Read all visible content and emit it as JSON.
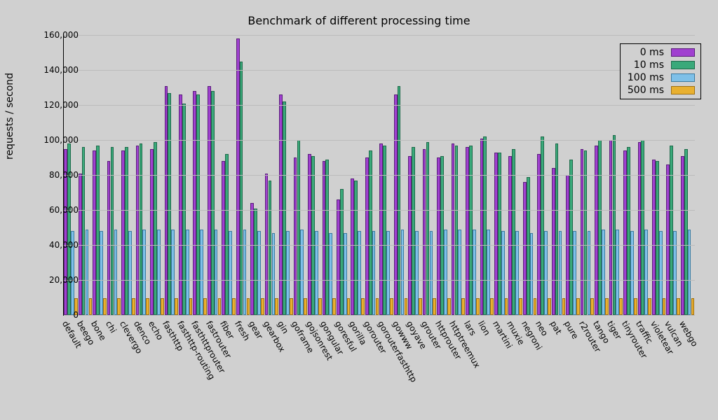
{
  "chart_data": {
    "type": "bar",
    "title": "Benchmark of different processing time",
    "ylabel": "requests / second",
    "ylim": [
      0,
      160000
    ],
    "yticks": [
      0,
      20000,
      40000,
      60000,
      80000,
      100000,
      120000,
      140000,
      160000
    ],
    "legend_position": "upper right",
    "categories": [
      "default",
      "beego",
      "bone",
      "chi",
      "clevergo",
      "denco",
      "echo",
      "fasthttp",
      "fasthttp-routing",
      "fasthttprouter",
      "fastrouter",
      "fiber",
      "fresh",
      "gear",
      "gearbox",
      "gin",
      "goframe",
      "gojsonrest",
      "gongular",
      "goresful",
      "gorilla",
      "gorouter",
      "gorouterfasthttp",
      "gowww",
      "goyave",
      "grouter",
      "httprouter",
      "httptreemux",
      "lars",
      "lion",
      "martini",
      "muxie",
      "negroni",
      "neo",
      "pat",
      "pure",
      "r2router",
      "tango",
      "tiger",
      "tinyrouter",
      "traffic",
      "violetear",
      "vulcan",
      "webgo"
    ],
    "series": [
      {
        "name": "0 ms",
        "color": "#a040d0",
        "values": [
          95000,
          81000,
          94000,
          88000,
          94000,
          97000,
          95000,
          131000,
          126000,
          128000,
          131000,
          88000,
          158000,
          64000,
          81000,
          126000,
          90000,
          92000,
          88000,
          66000,
          78000,
          90000,
          98000,
          126000,
          91000,
          95000,
          90000,
          98000,
          96000,
          101000,
          93000,
          91000,
          76000,
          92000,
          84000,
          80000,
          95000,
          97000,
          100000,
          94000,
          99000,
          89000,
          86000,
          91000
        ]
      },
      {
        "name": "10 ms",
        "color": "#3aa97a",
        "values": [
          98000,
          96000,
          97000,
          96000,
          96000,
          98000,
          99000,
          127000,
          121000,
          126000,
          128000,
          92000,
          145000,
          61000,
          77000,
          122000,
          100000,
          91000,
          89000,
          72000,
          77000,
          94000,
          97000,
          131000,
          96000,
          99000,
          91000,
          97000,
          97000,
          102000,
          93000,
          95000,
          79000,
          102000,
          98000,
          89000,
          94000,
          100000,
          103000,
          96000,
          100000,
          88000,
          97000,
          95000
        ]
      },
      {
        "name": "100 ms",
        "color": "#7ec0e8",
        "values": [
          48000,
          49000,
          48000,
          49000,
          48000,
          49000,
          49000,
          49000,
          49000,
          49000,
          49000,
          48000,
          49000,
          48000,
          47000,
          48000,
          49000,
          48000,
          47000,
          47000,
          48000,
          48000,
          48000,
          49000,
          48000,
          48000,
          49000,
          49000,
          49000,
          49000,
          48000,
          48000,
          47000,
          48000,
          48000,
          48000,
          48000,
          49000,
          49000,
          48000,
          49000,
          48000,
          48000,
          49000
        ]
      },
      {
        "name": "500 ms",
        "color": "#e8b030",
        "values": [
          9800,
          9800,
          9800,
          9800,
          9800,
          9800,
          9800,
          9800,
          9800,
          9800,
          9800,
          9800,
          9800,
          9800,
          9800,
          9800,
          9800,
          9800,
          9800,
          9800,
          9800,
          9800,
          9800,
          9800,
          9800,
          9800,
          9800,
          9800,
          9800,
          9800,
          9800,
          9800,
          9800,
          9800,
          9800,
          9800,
          9800,
          9800,
          9800,
          9800,
          9800,
          9800,
          9800,
          9800
        ]
      }
    ]
  }
}
